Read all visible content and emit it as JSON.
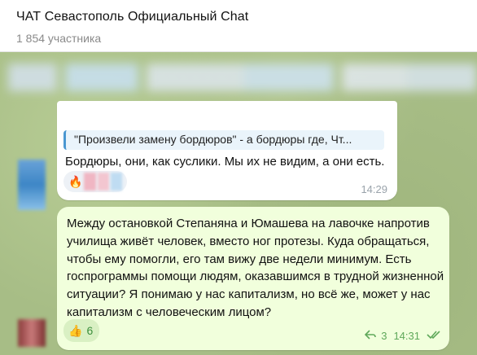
{
  "header": {
    "title": "ЧАТ Севастополь Официальный Chat",
    "subtitle": "1 854 участника"
  },
  "messages": [
    {
      "reply_quote": "\"Произвели замену бордюров\" - а бордюры где, Чт...",
      "text": "Бордюры, они, как суслики. Мы их не видим, а они есть.",
      "reaction_emoji": "🔥",
      "time": "14:29"
    },
    {
      "text": "Между остановкой Степаняна и Юмашева на лавочке напротив училища живёт человек, вместо ног протезы. Куда обращаться, чтобы ему помогли, его там вижу две недели минимум. Есть госпрограммы помощи людям, оказавшимся в трудной жизненной ситуации? Я понимаю у нас капитализм, но всё же, может у нас капитализм с человеческим лицом?",
      "reaction_emoji": "👍",
      "reaction_count": "6",
      "replies_count": "3",
      "time": "14:31"
    }
  ],
  "colors": {
    "chat_bg": "#a7bd86",
    "outgoing_bubble": "#f1ffdc",
    "accent_green": "#5fa85a",
    "reply_bar": "#4a97d1"
  },
  "icons": {
    "reply": "reply-arrow-icon",
    "read": "double-check-icon"
  }
}
